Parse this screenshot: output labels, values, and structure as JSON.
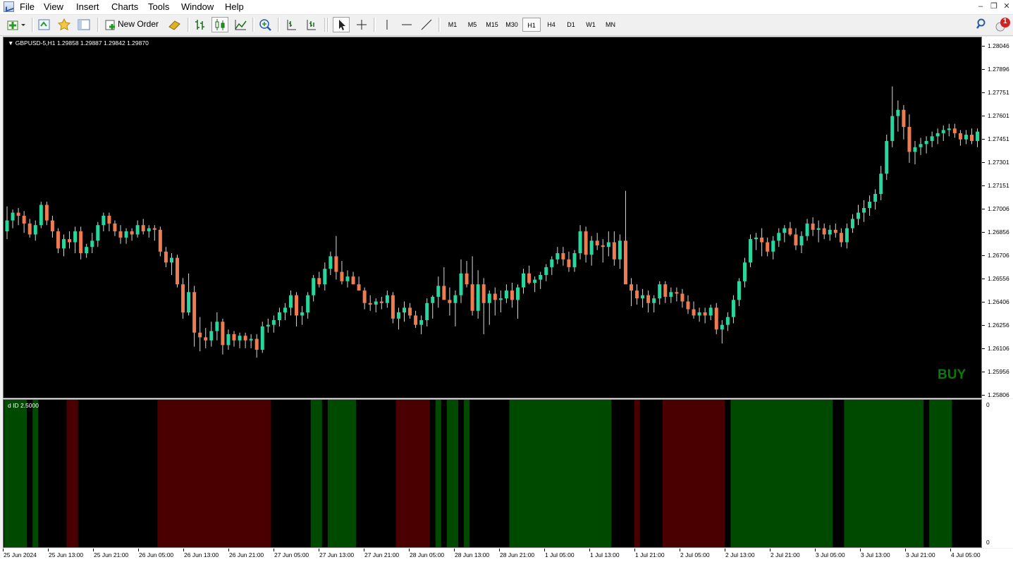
{
  "menu": [
    "File",
    "View",
    "Insert",
    "Charts",
    "Tools",
    "Window",
    "Help"
  ],
  "toolbar": {
    "new_order_label": "New Order",
    "timeframes": [
      "M1",
      "M5",
      "M15",
      "M30",
      "H1",
      "H4",
      "D1",
      "W1",
      "MN"
    ],
    "active_timeframe": "H1",
    "notification_count": "1"
  },
  "chart": {
    "title": "GBPUSD-5,H1  1.29858 1.29887 1.29842 1.29870",
    "signal_label": "BUY",
    "signal_color": "#0a7a0a",
    "bull_color": "#26d8a0",
    "bear_color": "#ef7c50",
    "background": "#000000"
  },
  "price_axis": [
    "1.28046",
    "1.27896",
    "1.27751",
    "1.27601",
    "1.27451",
    "1.27301",
    "1.27151",
    "1.27006",
    "1.26856",
    "1.26706",
    "1.26556",
    "1.26406",
    "1.26256",
    "1.26106",
    "1.25956",
    "1.25806"
  ],
  "indicator": {
    "title": "d ID 2.5000",
    "scale_top": "0",
    "scale_bottom": "0",
    "green_color": "#004a00",
    "red_color": "#4a0000"
  },
  "time_axis": [
    "25 Jun 2024",
    "25 Jun 13:00",
    "25 Jun 21:00",
    "26 Jun 05:00",
    "26 Jun 13:00",
    "26 Jun 21:00",
    "27 Jun 05:00",
    "27 Jun 13:00",
    "27 Jun 21:00",
    "28 Jun 05:00",
    "28 Jun 13:00",
    "28 Jun 21:00",
    "1 Jul 05:00",
    "1 Jul 13:00",
    "1 Jul 21:00",
    "2 Jul 05:00",
    "2 Jul 13:00",
    "2 Jul 21:00",
    "3 Jul 05:00",
    "3 Jul 13:00",
    "3 Jul 21:00",
    "4 Jul 05:00"
  ],
  "chart_data": {
    "type": "candlestick",
    "symbol": "GBPUSD-5",
    "timeframe": "H1",
    "x_start": "25 Jun 2024 05:00",
    "x_step_hours": 1,
    "ylim": [
      1.25806,
      1.28046
    ],
    "ohlc": [
      [
        1.2686,
        1.2702,
        1.2681,
        1.2693
      ],
      [
        1.2693,
        1.27,
        1.2688,
        1.2698
      ],
      [
        1.2698,
        1.2701,
        1.269,
        1.2696
      ],
      [
        1.2696,
        1.2699,
        1.2685,
        1.2691
      ],
      [
        1.2691,
        1.2694,
        1.2682,
        1.2684
      ],
      [
        1.2684,
        1.2693,
        1.268,
        1.269
      ],
      [
        1.269,
        1.2705,
        1.2688,
        1.2703
      ],
      [
        1.2703,
        1.2705,
        1.269,
        1.2693
      ],
      [
        1.2693,
        1.2696,
        1.2682,
        1.2686
      ],
      [
        1.2686,
        1.2688,
        1.2672,
        1.2675
      ],
      [
        1.2675,
        1.2684,
        1.267,
        1.2681
      ],
      [
        1.2681,
        1.2686,
        1.2675,
        1.2679
      ],
      [
        1.2679,
        1.2689,
        1.2672,
        1.2686
      ],
      [
        1.2686,
        1.2689,
        1.2668,
        1.2672
      ],
      [
        1.2672,
        1.2678,
        1.2669,
        1.2676
      ],
      [
        1.2676,
        1.2685,
        1.2672,
        1.268
      ],
      [
        1.268,
        1.2692,
        1.2676,
        1.269
      ],
      [
        1.269,
        1.2698,
        1.2686,
        1.2696
      ],
      [
        1.2696,
        1.2698,
        1.2686,
        1.2691
      ],
      [
        1.2691,
        1.2693,
        1.2683,
        1.2686
      ],
      [
        1.2686,
        1.269,
        1.2678,
        1.2682
      ],
      [
        1.2682,
        1.2688,
        1.2678,
        1.2686
      ],
      [
        1.2686,
        1.2688,
        1.268,
        1.2684
      ],
      [
        1.2684,
        1.2693,
        1.2682,
        1.269
      ],
      [
        1.269,
        1.2694,
        1.2684,
        1.2686
      ],
      [
        1.2686,
        1.269,
        1.2682,
        1.2688
      ],
      [
        1.2688,
        1.269,
        1.268,
        1.2687
      ],
      [
        1.2687,
        1.2689,
        1.267,
        1.2673
      ],
      [
        1.2673,
        1.2676,
        1.2663,
        1.2666
      ],
      [
        1.2666,
        1.2672,
        1.2658,
        1.2669
      ],
      [
        1.2669,
        1.2671,
        1.265,
        1.2652
      ],
      [
        1.2652,
        1.2656,
        1.263,
        1.2634
      ],
      [
        1.2634,
        1.2659,
        1.2632,
        1.2647
      ],
      [
        1.2647,
        1.2651,
        1.2612,
        1.2621
      ],
      [
        1.2621,
        1.2631,
        1.2609,
        1.2618
      ],
      [
        1.2618,
        1.2624,
        1.2611,
        1.2616
      ],
      [
        1.2616,
        1.2628,
        1.2612,
        1.2622
      ],
      [
        1.2622,
        1.2634,
        1.2616,
        1.2628
      ],
      [
        1.2628,
        1.263,
        1.2607,
        1.2613
      ],
      [
        1.2613,
        1.2623,
        1.261,
        1.262
      ],
      [
        1.262,
        1.2622,
        1.2612,
        1.2616
      ],
      [
        1.2616,
        1.2621,
        1.2611,
        1.2619
      ],
      [
        1.2619,
        1.2621,
        1.2611,
        1.2616
      ],
      [
        1.2616,
        1.262,
        1.2611,
        1.2617
      ],
      [
        1.2617,
        1.262,
        1.2605,
        1.261
      ],
      [
        1.261,
        1.2628,
        1.2608,
        1.2625
      ],
      [
        1.2625,
        1.263,
        1.2621,
        1.2626
      ],
      [
        1.2626,
        1.2632,
        1.2621,
        1.2629
      ],
      [
        1.2629,
        1.2637,
        1.2625,
        1.2634
      ],
      [
        1.2634,
        1.264,
        1.2629,
        1.2637
      ],
      [
        1.2637,
        1.2648,
        1.2632,
        1.2645
      ],
      [
        1.2645,
        1.2647,
        1.2625,
        1.2632
      ],
      [
        1.2632,
        1.2638,
        1.2626,
        1.2634
      ],
      [
        1.2634,
        1.2647,
        1.263,
        1.2645
      ],
      [
        1.2645,
        1.2658,
        1.2641,
        1.2656
      ],
      [
        1.2656,
        1.266,
        1.265,
        1.2652
      ],
      [
        1.2652,
        1.2666,
        1.2648,
        1.2662
      ],
      [
        1.2662,
        1.2673,
        1.2658,
        1.267
      ],
      [
        1.267,
        1.2683,
        1.2655,
        1.266
      ],
      [
        1.266,
        1.2667,
        1.2652,
        1.2654
      ],
      [
        1.2654,
        1.2661,
        1.265,
        1.2657
      ],
      [
        1.2657,
        1.266,
        1.2652,
        1.2652
      ],
      [
        1.2652,
        1.2657,
        1.2648,
        1.2648
      ],
      [
        1.2648,
        1.265,
        1.2636,
        1.264
      ],
      [
        1.264,
        1.2645,
        1.2635,
        1.2639
      ],
      [
        1.2639,
        1.2643,
        1.2634,
        1.2641
      ],
      [
        1.2641,
        1.2644,
        1.2636,
        1.264
      ],
      [
        1.264,
        1.2648,
        1.2637,
        1.2645
      ],
      [
        1.2645,
        1.2647,
        1.2627,
        1.263
      ],
      [
        1.263,
        1.2637,
        1.2623,
        1.2634
      ],
      [
        1.2634,
        1.2641,
        1.2628,
        1.2637
      ],
      [
        1.2637,
        1.264,
        1.263,
        1.2632
      ],
      [
        1.2632,
        1.2635,
        1.2624,
        1.2626
      ],
      [
        1.2626,
        1.2632,
        1.262,
        1.2629
      ],
      [
        1.2629,
        1.2643,
        1.2625,
        1.264
      ],
      [
        1.264,
        1.2645,
        1.263,
        1.2644
      ],
      [
        1.2644,
        1.2657,
        1.2637,
        1.2651
      ],
      [
        1.2651,
        1.2663,
        1.2645,
        1.2642
      ],
      [
        1.2642,
        1.265,
        1.2632,
        1.264
      ],
      [
        1.264,
        1.2648,
        1.2625,
        1.2645
      ],
      [
        1.2645,
        1.2668,
        1.264,
        1.2659
      ],
      [
        1.2659,
        1.2667,
        1.265,
        1.2652
      ],
      [
        1.2652,
        1.267,
        1.2632,
        1.2635
      ],
      [
        1.2635,
        1.2661,
        1.263,
        1.2652
      ],
      [
        1.2652,
        1.2656,
        1.262,
        1.264
      ],
      [
        1.264,
        1.2648,
        1.2626,
        1.2646
      ],
      [
        1.2646,
        1.265,
        1.2632,
        1.2642
      ],
      [
        1.2642,
        1.2648,
        1.2634,
        1.2643
      ],
      [
        1.2643,
        1.2652,
        1.264,
        1.2648
      ],
      [
        1.2648,
        1.2653,
        1.2637,
        1.2642
      ],
      [
        1.2642,
        1.2652,
        1.263,
        1.265
      ],
      [
        1.265,
        1.2662,
        1.2646,
        1.2659
      ],
      [
        1.2659,
        1.2664,
        1.2652,
        1.2653
      ],
      [
        1.2653,
        1.2657,
        1.2647,
        1.2655
      ],
      [
        1.2655,
        1.266,
        1.2649,
        1.2658
      ],
      [
        1.2658,
        1.2665,
        1.2654,
        1.2663
      ],
      [
        1.2663,
        1.267,
        1.2658,
        1.2668
      ],
      [
        1.2668,
        1.2676,
        1.2665,
        1.2672
      ],
      [
        1.2672,
        1.2676,
        1.2664,
        1.2668
      ],
      [
        1.2668,
        1.2673,
        1.266,
        1.2663
      ],
      [
        1.2663,
        1.2674,
        1.266,
        1.2672
      ],
      [
        1.2672,
        1.269,
        1.2668,
        1.2686
      ],
      [
        1.2686,
        1.2689,
        1.2666,
        1.2671
      ],
      [
        1.2671,
        1.2683,
        1.2664,
        1.268
      ],
      [
        1.268,
        1.2685,
        1.2674,
        1.2677
      ],
      [
        1.2677,
        1.2681,
        1.2666,
        1.2676
      ],
      [
        1.2676,
        1.2686,
        1.267,
        1.2679
      ],
      [
        1.2679,
        1.2686,
        1.2664,
        1.2668
      ],
      [
        1.2668,
        1.2684,
        1.2662,
        1.268
      ],
      [
        1.268,
        1.2712,
        1.2654,
        1.2652
      ],
      [
        1.2652,
        1.2656,
        1.2638,
        1.2648
      ],
      [
        1.2648,
        1.2652,
        1.2639,
        1.2643
      ],
      [
        1.2643,
        1.2649,
        1.2637,
        1.2645
      ],
      [
        1.2645,
        1.2648,
        1.2634,
        1.264
      ],
      [
        1.264,
        1.2645,
        1.2634,
        1.2643
      ],
      [
        1.2643,
        1.2654,
        1.2639,
        1.2652
      ],
      [
        1.2652,
        1.2654,
        1.264,
        1.2644
      ],
      [
        1.2644,
        1.265,
        1.264,
        1.2647
      ],
      [
        1.2647,
        1.265,
        1.2641,
        1.2646
      ],
      [
        1.2646,
        1.2649,
        1.2637,
        1.2641
      ],
      [
        1.2641,
        1.2645,
        1.2633,
        1.2636
      ],
      [
        1.2636,
        1.2641,
        1.263,
        1.2632
      ],
      [
        1.2632,
        1.2637,
        1.2628,
        1.2634
      ],
      [
        1.2634,
        1.2637,
        1.2627,
        1.2632
      ],
      [
        1.2632,
        1.2639,
        1.2629,
        1.2637
      ],
      [
        1.2637,
        1.264,
        1.262,
        1.2623
      ],
      [
        1.2623,
        1.2629,
        1.2614,
        1.2626
      ],
      [
        1.2626,
        1.2634,
        1.2622,
        1.2631
      ],
      [
        1.2631,
        1.2645,
        1.2627,
        1.2642
      ],
      [
        1.2642,
        1.2656,
        1.2638,
        1.2654
      ],
      [
        1.2654,
        1.2669,
        1.265,
        1.2666
      ],
      [
        1.2666,
        1.2684,
        1.2663,
        1.2681
      ],
      [
        1.2681,
        1.2685,
        1.2674,
        1.2682
      ],
      [
        1.2682,
        1.2688,
        1.267,
        1.2679
      ],
      [
        1.2679,
        1.2682,
        1.267,
        1.2673
      ],
      [
        1.2673,
        1.2683,
        1.2668,
        1.268
      ],
      [
        1.268,
        1.2688,
        1.2676,
        1.2685
      ],
      [
        1.2685,
        1.269,
        1.2679,
        1.2688
      ],
      [
        1.2688,
        1.2692,
        1.2683,
        1.2684
      ],
      [
        1.2684,
        1.2688,
        1.2674,
        1.2677
      ],
      [
        1.2677,
        1.2686,
        1.2672,
        1.2683
      ],
      [
        1.2683,
        1.2694,
        1.268,
        1.2691
      ],
      [
        1.2691,
        1.2695,
        1.2683,
        1.2687
      ],
      [
        1.2687,
        1.2693,
        1.2679,
        1.2688
      ],
      [
        1.2688,
        1.2691,
        1.2681,
        1.2684
      ],
      [
        1.2684,
        1.269,
        1.268,
        1.2687
      ],
      [
        1.2687,
        1.2691,
        1.2682,
        1.2685
      ],
      [
        1.2685,
        1.2688,
        1.2676,
        1.2679
      ],
      [
        1.2679,
        1.2691,
        1.2675,
        1.2688
      ],
      [
        1.2688,
        1.2697,
        1.2685,
        1.2694
      ],
      [
        1.2694,
        1.2703,
        1.269,
        1.2698
      ],
      [
        1.2698,
        1.2706,
        1.2692,
        1.2701
      ],
      [
        1.2701,
        1.2709,
        1.2696,
        1.2705
      ],
      [
        1.2705,
        1.2713,
        1.27,
        1.271
      ],
      [
        1.271,
        1.2728,
        1.2706,
        1.2723
      ],
      [
        1.2723,
        1.2748,
        1.2719,
        1.2744
      ],
      [
        1.2744,
        1.2779,
        1.274,
        1.276
      ],
      [
        1.276,
        1.277,
        1.275,
        1.2764
      ],
      [
        1.2764,
        1.2767,
        1.2745,
        1.2753
      ],
      [
        1.2753,
        1.2761,
        1.273,
        1.2737
      ],
      [
        1.2737,
        1.2744,
        1.2729,
        1.274
      ],
      [
        1.274,
        1.2746,
        1.2735,
        1.2742
      ],
      [
        1.2742,
        1.2747,
        1.2736,
        1.2744
      ],
      [
        1.2744,
        1.275,
        1.274,
        1.2747
      ],
      [
        1.2747,
        1.2752,
        1.2742,
        1.2749
      ],
      [
        1.2749,
        1.2754,
        1.2744,
        1.2751
      ],
      [
        1.2751,
        1.2755,
        1.2747,
        1.2752
      ],
      [
        1.2752,
        1.2755,
        1.2746,
        1.2749
      ],
      [
        1.2749,
        1.2751,
        1.2741,
        1.2745
      ],
      [
        1.2745,
        1.2751,
        1.2742,
        1.2748
      ],
      [
        1.2748,
        1.2752,
        1.2742,
        1.2744
      ],
      [
        1.2744,
        1.2752,
        1.274,
        1.275
      ],
      [
        1.275,
        1.2756,
        1.2746,
        1.2755
      ]
    ],
    "indicator_blocks": [
      {
        "color": "green",
        "from": 0,
        "to": 3
      },
      {
        "color": "green",
        "from": 5,
        "to": 5
      },
      {
        "color": "red",
        "from": 11,
        "to": 12
      },
      {
        "color": "red",
        "from": 27,
        "to": 46
      },
      {
        "color": "green",
        "from": 54,
        "to": 55
      },
      {
        "color": "green",
        "from": 57,
        "to": 61
      },
      {
        "color": "red",
        "from": 69,
        "to": 74
      },
      {
        "color": "green",
        "from": 76,
        "to": 76
      },
      {
        "color": "green",
        "from": 78,
        "to": 79
      },
      {
        "color": "green",
        "from": 81,
        "to": 81
      },
      {
        "color": "green",
        "from": 89,
        "to": 106
      },
      {
        "color": "red",
        "from": 111,
        "to": 111
      },
      {
        "color": "red",
        "from": 116,
        "to": 126
      },
      {
        "color": "green",
        "from": 128,
        "to": 145
      },
      {
        "color": "green",
        "from": 148,
        "to": 161
      },
      {
        "color": "green",
        "from": 163,
        "to": 166
      }
    ]
  }
}
